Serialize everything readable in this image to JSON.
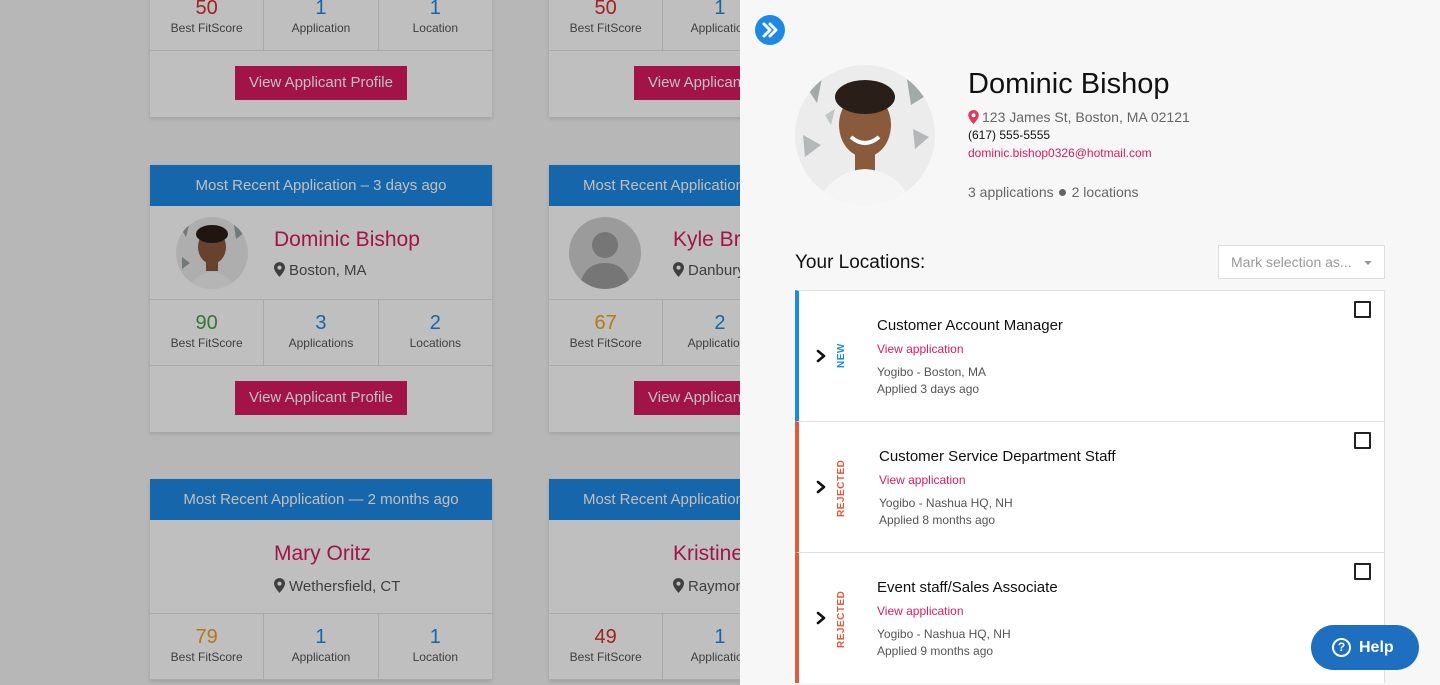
{
  "background_cards": {
    "row1_left": {
      "stats": [
        {
          "value": "50",
          "label": "Best FitScore"
        },
        {
          "value": "1",
          "label": "Application"
        },
        {
          "value": "1",
          "label": "Location"
        }
      ],
      "button_label": "View Applicant Profile"
    },
    "row1_right": {
      "stats": [
        {
          "value": "50",
          "label": "Best FitScore"
        },
        {
          "value": "1",
          "label": "Application"
        }
      ],
      "button_label": "View Applicant Profile"
    },
    "row2_left": {
      "header": "Most Recent Application – 3 days ago",
      "name": "Dominic Bishop",
      "location": "Boston, MA",
      "stats": [
        {
          "value": "90",
          "label": "Best FitScore"
        },
        {
          "value": "3",
          "label": "Applications"
        },
        {
          "value": "2",
          "label": "Locations"
        }
      ],
      "button_label": "View Applicant Profile"
    },
    "row2_right": {
      "header": "Most Recent Application",
      "name": "Kyle Bro",
      "location": "Danbury",
      "stats": [
        {
          "value": "67",
          "label": "Best FitScore"
        },
        {
          "value": "2",
          "label": "Applications"
        }
      ],
      "button_label": "View Applicant Profile"
    },
    "row3_left": {
      "header": "Most Recent Application — 2 months ago",
      "name": "Mary Oritz",
      "location": "Wethersfield, CT",
      "stats": [
        {
          "value": "79",
          "label": "Best FitScore"
        },
        {
          "value": "1",
          "label": "Application"
        },
        {
          "value": "1",
          "label": "Location"
        }
      ],
      "button_label": "View Applicant Profile"
    },
    "row3_right": {
      "header": "Most Recent Application",
      "name": "Kristine",
      "location": "Raymon",
      "stats": [
        {
          "value": "49",
          "label": "Best FitScore"
        },
        {
          "value": "1",
          "label": "Application"
        }
      ],
      "button_label": "View Applicant Profile"
    }
  },
  "panel": {
    "name": "Dominic Bishop",
    "address": "123 James St, Boston, MA 02121",
    "phone": "(617) 555-5555",
    "email": "dominic.bishop0326@hotmail.com",
    "applications_count": "3 applications",
    "locations_count": "2 locations",
    "locations_title": "Your Locations:",
    "mark_selection_placeholder": "Mark selection as...",
    "applications": [
      {
        "status": "NEW",
        "title": "Customer Account Manager",
        "link": "View application",
        "company": "Yogibo -  Boston, MA",
        "applied": "Applied 3 days ago"
      },
      {
        "status": "REJECTED",
        "title": "Customer Service Department Staff",
        "link": "View application",
        "company": "Yogibo - Nashua HQ, NH",
        "applied": "Applied 8 months ago"
      },
      {
        "status": "REJECTED",
        "title": "Event staff/Sales Associate",
        "link": "View application",
        "company": "Yogibo - Nashua HQ, NH",
        "applied": "Applied 9 months ago"
      }
    ],
    "help_label": "Help"
  },
  "colors": {
    "primary_blue": "#1e88e5",
    "accent_pink": "#d81b60",
    "rejected_red": "#e05a3c",
    "fitscore_green": "#43a047",
    "fitscore_orange": "#f0a020",
    "fitscore_red": "#d32f2f"
  },
  "icons": [
    "double-chevron-right-icon",
    "map-pin-icon",
    "chevron-right-icon",
    "help-question-icon",
    "caret-down-icon"
  ]
}
